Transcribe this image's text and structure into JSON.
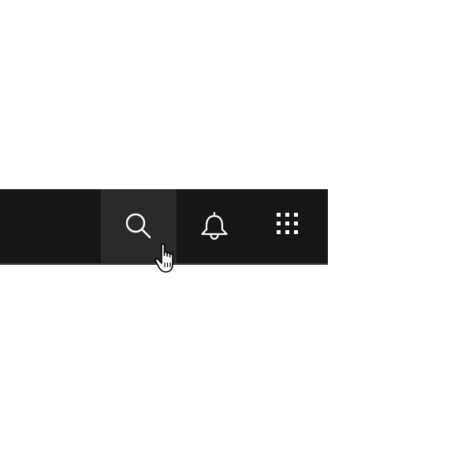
{
  "header": {
    "actions": [
      {
        "icon": "search-icon",
        "label": "Search",
        "state": "hovered"
      },
      {
        "icon": "notification-icon",
        "label": "Notifications",
        "state": "default"
      },
      {
        "icon": "app-switcher-icon",
        "label": "App switcher",
        "state": "default"
      }
    ]
  },
  "colors": {
    "header_background": "#161616",
    "hover_background": "#2a2a2a",
    "icon": "#ffffff",
    "border": "#3d3d3d",
    "page_background": "#ffffff"
  },
  "cursor": {
    "icon": "hand-pointer-icon"
  }
}
